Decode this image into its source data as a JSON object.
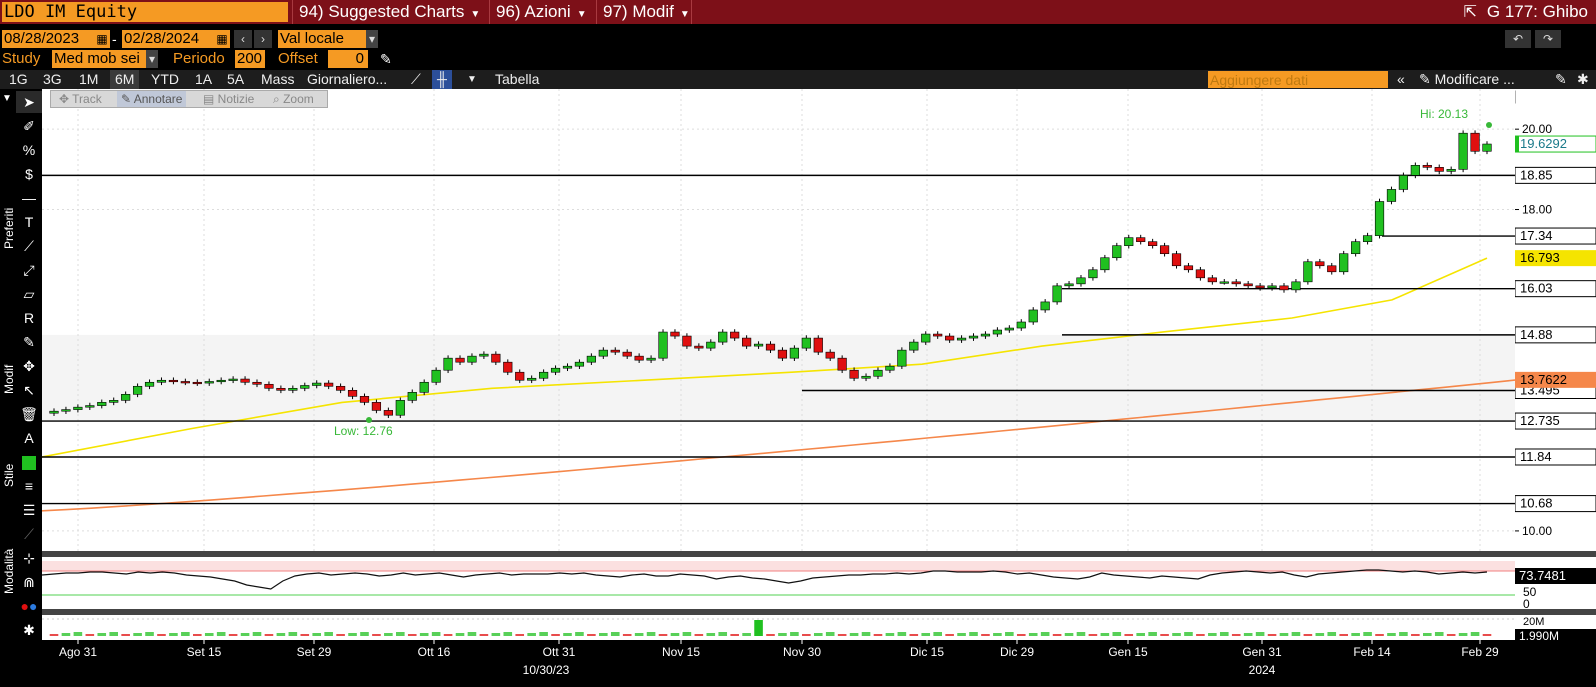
{
  "header": {
    "ticker": "LDO IM Equity",
    "menus": [
      {
        "num": "94)",
        "label": "Suggested Charts"
      },
      {
        "num": "96)",
        "label": "Azioni"
      },
      {
        "num": "97)",
        "label": "Modif"
      }
    ],
    "window_title": "G 177: Ghibo"
  },
  "dates": {
    "start": "08/28/2023",
    "sep": "-",
    "end": "02/28/2024",
    "currency": "Val locale"
  },
  "study": {
    "label": "Study",
    "value": "Med mob sei",
    "period_label": "Periodo",
    "period_value": "200",
    "offset_label": "Offset",
    "offset_value": "0"
  },
  "toolbar": {
    "ranges": [
      "1G",
      "3G",
      "1M",
      "6M",
      "YTD",
      "1A",
      "5A",
      "Mass"
    ],
    "selected_range": "6M",
    "frequency": "Giornaliero...",
    "table": "Tabella",
    "add_data_placeholder": "Aggiungere dati",
    "modify": "Modificare ..."
  },
  "chart_tools": [
    "Track",
    "Annotare",
    "Notizie",
    "Zoom"
  ],
  "rail_labels": {
    "preferiti": "Preferiti",
    "modif": "Modif",
    "stile": "Stile",
    "modalita": "Modalità"
  },
  "colors": {
    "up": "#20c020",
    "down": "#e01010",
    "sma_short": "#f5e400",
    "sma_long": "#f5874a",
    "accent": "#f59a23",
    "title_bar": "#7d1018"
  },
  "chart_data": {
    "type": "candlestick",
    "x_ticks": [
      "Ago 31",
      "Set 15",
      "Set 29",
      "Ott 16",
      "Ott 31",
      "Nov 15",
      "Nov 30",
      "Dic 15",
      "Dic 29",
      "Gen 15",
      "Gen 31",
      "Feb 14",
      "Feb 29"
    ],
    "year_label": "2024",
    "cursor_date": "10/30/23",
    "y_ticks": [
      "20.00",
      "18.00",
      "10.00"
    ],
    "ylim": [
      9.5,
      21.0
    ],
    "hi_label": "Hi: 20.13",
    "low_label": "Low: 12.76",
    "last_price": "19.6292",
    "sma_short_value": "16.793",
    "sma_long_value": "13.7622",
    "levels": [
      "18.85",
      "17.34",
      "16.03",
      "14.88",
      "13.495",
      "12.735",
      "11.84",
      "10.68"
    ],
    "closes": [
      12.98,
      13.02,
      13.08,
      13.12,
      13.2,
      13.25,
      13.4,
      13.6,
      13.7,
      13.75,
      13.72,
      13.7,
      13.68,
      13.72,
      13.75,
      13.78,
      13.7,
      13.65,
      13.55,
      13.5,
      13.55,
      13.62,
      13.68,
      13.6,
      13.5,
      13.35,
      13.2,
      13.0,
      12.88,
      13.25,
      13.45,
      13.7,
      14.0,
      14.3,
      14.2,
      14.35,
      14.4,
      14.2,
      13.95,
      13.75,
      13.8,
      13.95,
      14.05,
      14.1,
      14.2,
      14.35,
      14.5,
      14.45,
      14.35,
      14.25,
      14.3,
      14.95,
      14.85,
      14.6,
      14.55,
      14.7,
      14.95,
      14.8,
      14.6,
      14.65,
      14.5,
      14.3,
      14.55,
      14.8,
      14.45,
      14.3,
      14.0,
      13.8,
      13.85,
      14.0,
      14.1,
      14.5,
      14.7,
      14.9,
      14.85,
      14.75,
      14.8,
      14.85,
      14.9,
      15.0,
      15.05,
      15.2,
      15.5,
      15.7,
      16.1,
      16.15,
      16.3,
      16.5,
      16.8,
      17.1,
      17.3,
      17.2,
      17.1,
      16.9,
      16.6,
      16.5,
      16.3,
      16.2,
      16.2,
      16.15,
      16.1,
      16.05,
      16.1,
      16.0,
      16.2,
      16.7,
      16.6,
      16.45,
      16.9,
      17.2,
      17.35,
      18.2,
      18.5,
      18.85,
      19.1,
      19.05,
      18.95,
      19.0,
      19.9,
      19.45,
      19.63
    ],
    "sma_short_start": 11.84,
    "sma_short_end": 16.79,
    "sma_long_start": 10.5,
    "sma_long_end": 13.76,
    "rsi": {
      "value": "73.7481",
      "ticks": [
        "50",
        "0"
      ]
    },
    "volume": {
      "value": "1.990M",
      "tick": "20M"
    }
  }
}
